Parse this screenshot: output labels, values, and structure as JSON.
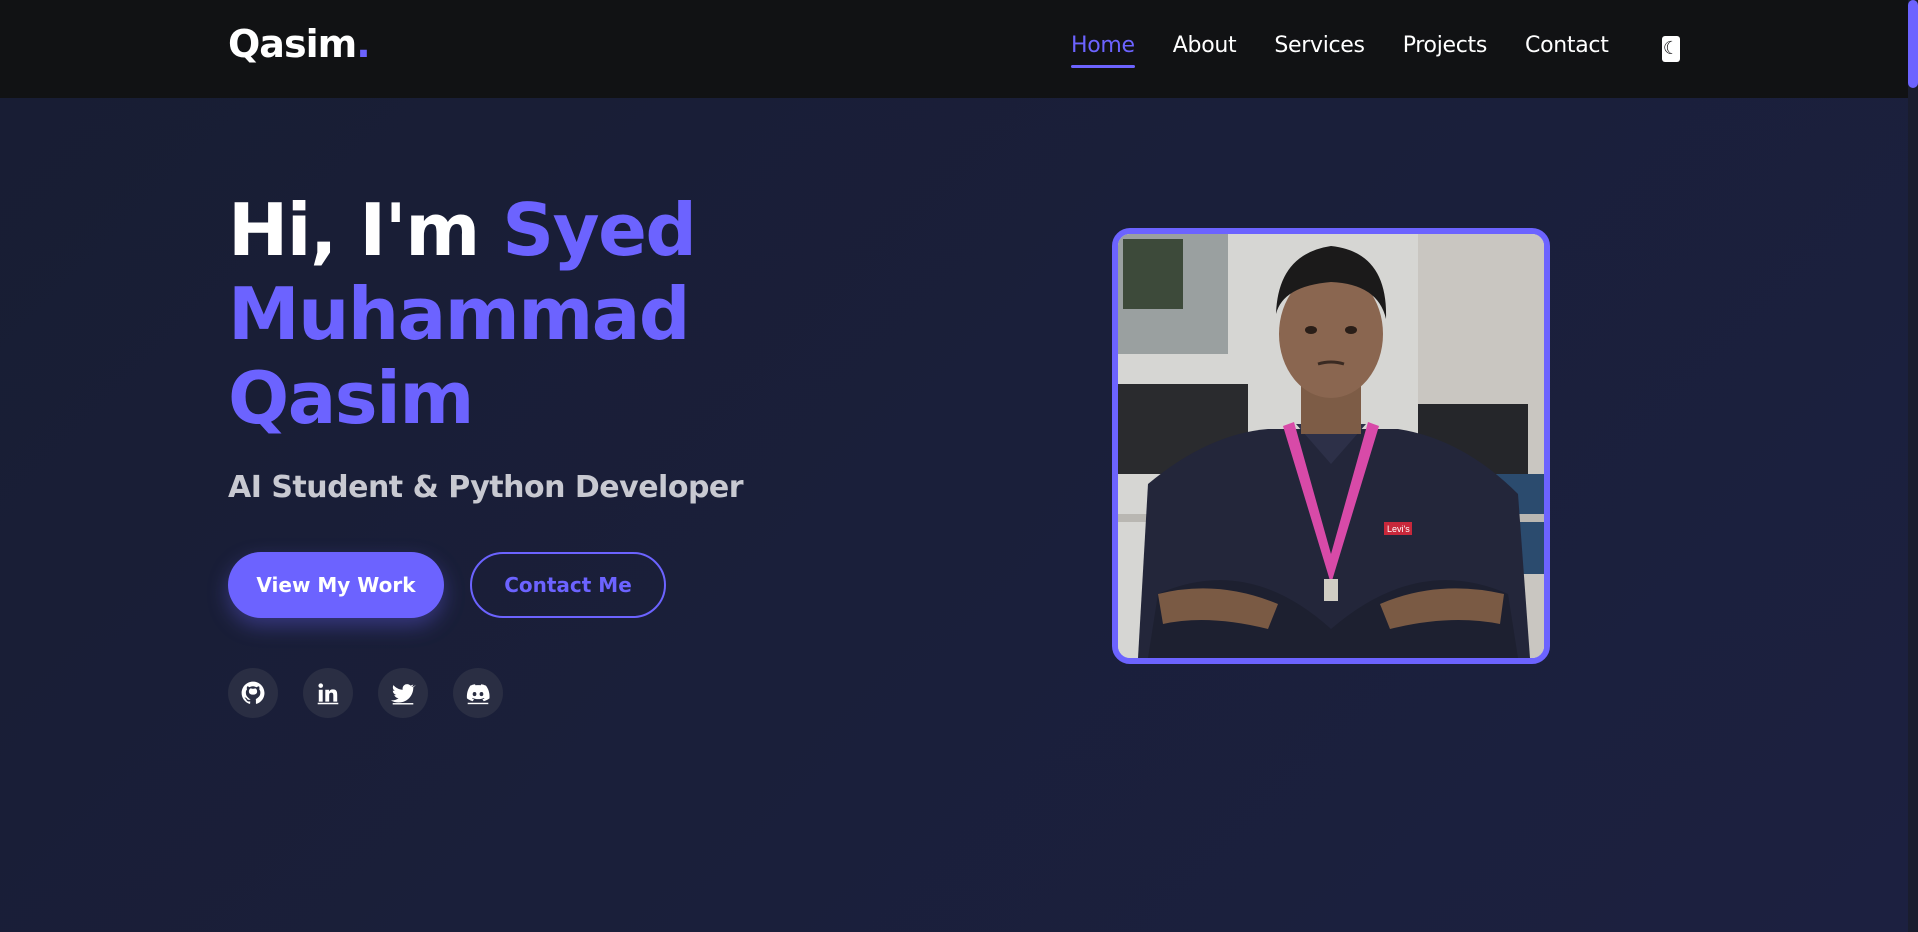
{
  "nav": {
    "logo_text": "Qasim",
    "logo_dot": ".",
    "links": [
      {
        "label": "Home",
        "active": true
      },
      {
        "label": "About",
        "active": false
      },
      {
        "label": "Services",
        "active": false
      },
      {
        "label": "Projects",
        "active": false
      },
      {
        "label": "Contact",
        "active": false
      }
    ],
    "theme_icon": "moon-icon"
  },
  "hero": {
    "greeting": "Hi, I'm ",
    "name_line1": "Syed",
    "name_line2": "Muhammad",
    "name_line3": "Qasim",
    "subtitle": "AI Student & Python Developer",
    "primary_button": "View My Work",
    "secondary_button": "Contact Me",
    "socials": [
      "github-icon",
      "linkedin-icon",
      "twitter-icon",
      "discord-icon"
    ],
    "photo_badge_text": "Levi's"
  },
  "colors": {
    "accent": "#6c63ff",
    "navbar_bg": "#111214",
    "page_bg": "#1a1f3a"
  }
}
